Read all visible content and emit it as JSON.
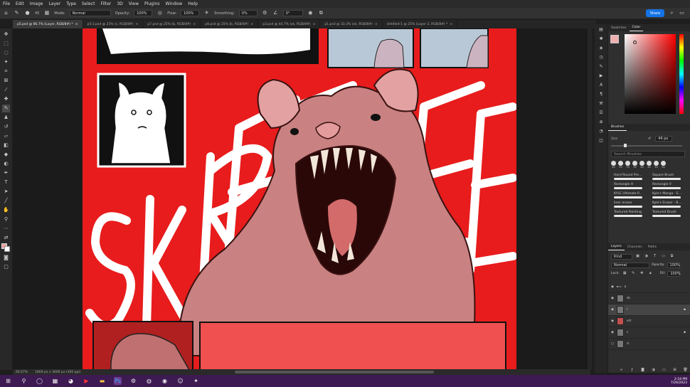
{
  "menu": [
    "File",
    "Edit",
    "Image",
    "Layer",
    "Type",
    "Select",
    "Filter",
    "3D",
    "View",
    "Plugins",
    "Window",
    "Help"
  ],
  "options": {
    "brush_size": "45",
    "mode_label": "Mode:",
    "mode_value": "Normal",
    "opacity_label": "Opacity:",
    "opacity_value": "100%",
    "flow_label": "Flow:",
    "flow_value": "100%",
    "smoothing_label": "Smoothing:",
    "smoothing_value": "0%",
    "angle_value": "0°",
    "share_label": "Share"
  },
  "tabs": [
    "p5.psd @ 66.7% (Layer, RGB/8#) *",
    "p5-2.psd @ 21% (s, RGB/8#)",
    "p7.psd @ 25% (b, RGB/8#)",
    "p8.psd @ 25% (b, RGB/8#)",
    "p3.psd @ 44.7% (sk, RGB/8#)",
    "p1.psd @ 33.3% (sk, RGB/8#)",
    "Untitled-1 @ 25% (Layer 2, RGB/8#) *"
  ],
  "status": {
    "zoom": "66.67%",
    "doc": "1800 px x 3600 px (300 ppi)"
  },
  "panel": {
    "swatches_tab": "Swatches",
    "color_tab": "Color",
    "brushes_tab": "Brushes",
    "size_label": "Size",
    "size_value": "44 px",
    "search_placeholder": "Search Brushes",
    "brush_sizes": [
      "44",
      "59",
      "70",
      "30",
      "45",
      "40",
      "30",
      "50"
    ],
    "brushes": [
      [
        "Hard Round Pre...",
        "Square Brush"
      ],
      [
        "Rectangle H",
        "Rectangle V"
      ],
      [
        "KYLE Ultimate P...",
        "Kyle's Manga - E..."
      ],
      [
        "liner eraser",
        "Kyle's Eraser - B..."
      ],
      [
        "Textured Painting",
        "Textured Brush"
      ]
    ],
    "layers_tab": "Layers",
    "channels_tab": "Channels",
    "paths_tab": "Paths",
    "kind_label": "Kind",
    "blend_value": "Normal",
    "opacity_label": "Opacity:",
    "opacity_value": "100%",
    "lock_label": "Lock:",
    "fill_label": "Fill:",
    "fill_value": "100%",
    "layers": [
      {
        "name": "a"
      },
      {
        "name": "sk"
      },
      {
        "name": "l"
      },
      {
        "name": "ert"
      },
      {
        "name": "c"
      },
      {
        "name": "d"
      }
    ]
  },
  "art": {
    "title_text": "SKREEEEE"
  },
  "clock": {
    "time": "2:18 PM",
    "date": "7/26/2023"
  },
  "colors": {
    "canvas_red": "#e81c1c",
    "accent_blue": "#1473e6"
  }
}
